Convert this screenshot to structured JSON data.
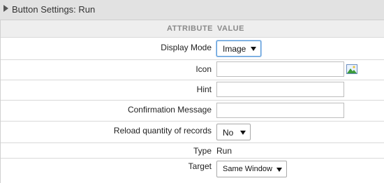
{
  "header": {
    "title": "Button Settings: Run"
  },
  "columns": {
    "attribute": "ATTRIBUTE",
    "value": "VALUE"
  },
  "rows": {
    "display_mode": {
      "label": "Display Mode",
      "value": "Image"
    },
    "icon": {
      "label": "Icon",
      "value": ""
    },
    "hint": {
      "label": "Hint",
      "value": ""
    },
    "confirmation_message": {
      "label": "Confirmation Message",
      "value": ""
    },
    "reload_quantity": {
      "label": "Reload quantity of records",
      "value": "No"
    },
    "type": {
      "label": "Type",
      "value": "Run"
    },
    "target": {
      "label": "Target",
      "value": "Same Window"
    }
  },
  "icons": {
    "collapse": "triangle-right-icon",
    "image_picker": "image-icon"
  },
  "colors": {
    "header_bg": "#e2e2e2",
    "column_head_bg": "#eeeeee",
    "focus_border": "#5b9dd9"
  }
}
